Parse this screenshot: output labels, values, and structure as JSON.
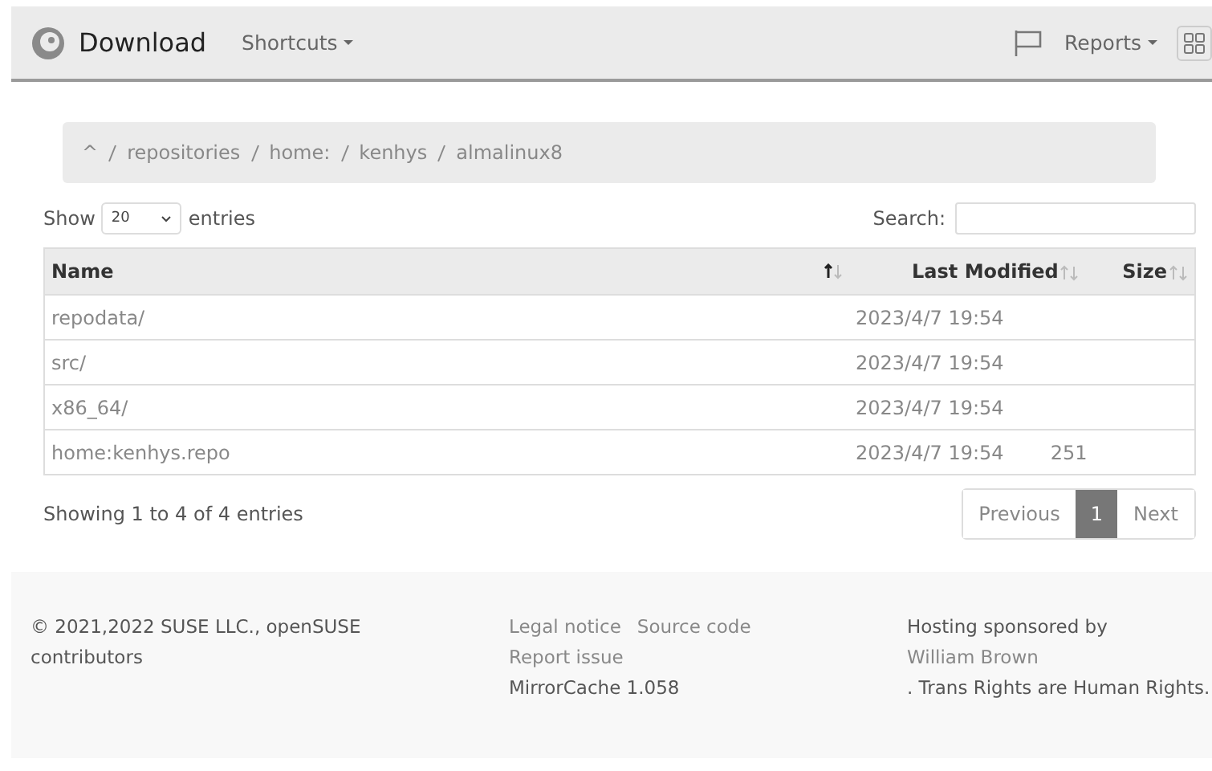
{
  "navbar": {
    "brand": "Download",
    "left_menus": [
      "Shortcuts"
    ],
    "right_menus": [
      "Reports"
    ]
  },
  "breadcrumb": [
    "^",
    "repositories",
    "home:",
    "kenhys",
    "almalinux8"
  ],
  "length_control": {
    "before": "Show",
    "value": "20",
    "after": "entries"
  },
  "search": {
    "label": "Search:"
  },
  "table": {
    "columns": [
      {
        "label": "Name",
        "sorted": true
      },
      {
        "label": "Last Modified",
        "sorted": false
      },
      {
        "label": "Size",
        "sorted": false
      }
    ],
    "rows": [
      [
        "repodata/",
        "2023/4/7 19:54",
        ""
      ],
      [
        "src/",
        "2023/4/7 19:54",
        ""
      ],
      [
        "x86_64/",
        "2023/4/7 19:54",
        ""
      ],
      [
        "home:kenhys.repo",
        "2023/4/7 19:54",
        "251"
      ]
    ]
  },
  "info": "Showing 1 to 4 of 4 entries",
  "pagination": [
    {
      "label": "Previous",
      "selected": false
    },
    {
      "label": "1",
      "selected": true
    },
    {
      "label": "Next",
      "selected": false
    }
  ],
  "footer": {
    "copyright": "© 2021,2022 SUSE LLC., openSUSE contributors",
    "links": [
      "Legal notice",
      "Source code",
      "Report issue"
    ],
    "version": "MirrorCache 1.058",
    "sponsor_text": "Hosting sponsored by",
    "sponsor_link": "William Brown",
    "tail": ". Trans Rights are Human Rights."
  }
}
